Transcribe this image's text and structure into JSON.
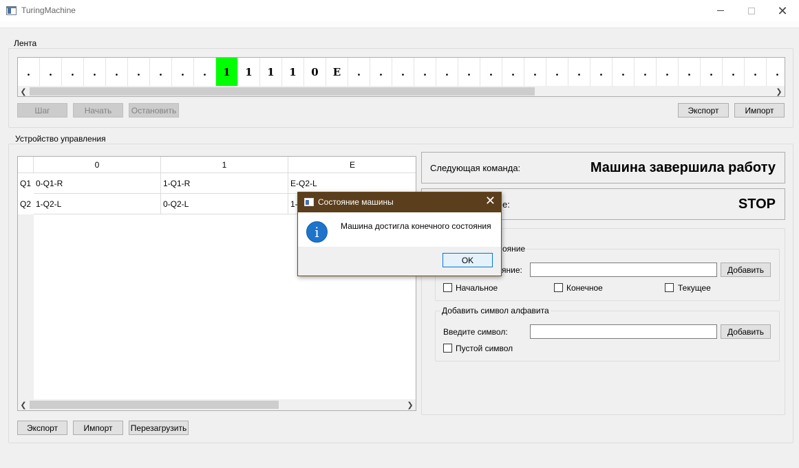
{
  "window": {
    "title": "TuringMachine"
  },
  "tape_group": {
    "title": "Лента",
    "cells": [
      ".",
      ".",
      ".",
      ".",
      ".",
      ".",
      ".",
      ".",
      ".",
      "1",
      "1",
      "1",
      "1",
      "0",
      "E",
      ".",
      ".",
      ".",
      ".",
      ".",
      ".",
      ".",
      ".",
      ".",
      ".",
      ".",
      ".",
      ".",
      ".",
      ".",
      ".",
      ".",
      ".",
      ".",
      "."
    ],
    "active_index": 9,
    "active_color": "#00ff00",
    "buttons": {
      "step": "Шаг",
      "start": "Начать",
      "stop": "Остановить",
      "export": "Экспорт",
      "import": "Импорт"
    }
  },
  "control_group": {
    "title": "Устройство управления",
    "table": {
      "columns": [
        "0",
        "1",
        "E"
      ],
      "rows": [
        {
          "state": "Q1",
          "cells": [
            "0-Q1-R",
            "1-Q1-R",
            "E-Q2-L"
          ]
        },
        {
          "state": "Q2",
          "cells": [
            "1-Q2-L",
            "0-Q2-L",
            "1-"
          ]
        }
      ]
    },
    "buttons": {
      "export": "Экспорт",
      "import": "Импорт",
      "reload": "Перезагрузить"
    },
    "next_command": {
      "label": "Следующая команда:",
      "value": "Машина завершила работу"
    },
    "state_panel": {
      "label_visible": "е:",
      "value": "STOP"
    },
    "add_state": {
      "title_visible": "ояние",
      "input_label_visible": "яние:",
      "add_label": "Добавить",
      "checkboxes": [
        "Начальное",
        "Конечное",
        "Текущее"
      ]
    },
    "add_symbol": {
      "title": "Добавить символ алфавита",
      "input_label": "Введите символ:",
      "add_label": "Добавить",
      "checkbox": "Пустой символ"
    }
  },
  "dialog": {
    "title": "Состояние машины",
    "message": "Машина достигла конечного состояния",
    "ok": "OK",
    "icon": "info-icon"
  }
}
